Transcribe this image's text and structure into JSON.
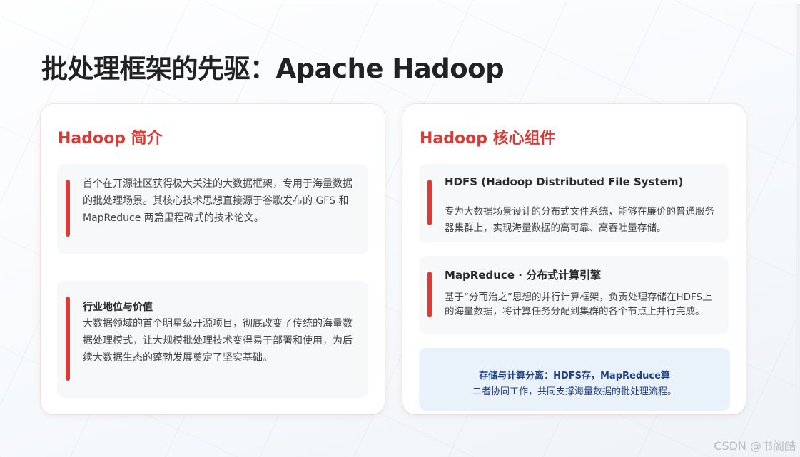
{
  "slide": {
    "title": "批处理框架的先驱：Apache Hadoop"
  },
  "left_card": {
    "title": "Hadoop 简介",
    "intro_text": "首个在开源社区获得极大关注的大数据框架，专用于海量数据的批处理场景。其核心技术思想直接源于谷歌发布的 GFS 和 MapReduce 两篇里程碑式的技术论文。",
    "status_heading": "行业地位与价值",
    "status_text": "大数据领域的首个明星级开源项目，彻底改变了传统的海量数据处理模式，让大规模批处理技术变得易于部署和使用，为后续大数据生态的蓬勃发展奠定了坚实基础。"
  },
  "right_card": {
    "title": "Hadoop 核心组件",
    "components": [
      {
        "heading": "HDFS (Hadoop Distributed File System)",
        "text": "专为大数据场景设计的分布式文件系统，能够在廉价的普通服务器集群上，实现海量数据的高可靠、高吞吐量存储。"
      },
      {
        "heading": "MapReduce · 分布式计算引擎",
        "text": "基于“分而治之”思想的并行计算框架，负责处理存储在HDFS上的海量数据，将计算任务分配到集群的各个节点上并行完成。"
      }
    ],
    "summary_line1": "存储与计算分离：HDFS存，MapReduce算",
    "summary_line2": "二者协同工作，共同支撑海量数据的批处理流程。"
  },
  "watermark": "CSDN @书阁酷",
  "colors": {
    "accent_red": "#dc3a36",
    "title_dark": "#222222",
    "summary_blue": "#1f3f86",
    "box_bg": "#f7f8fa",
    "summary_bg": "#e9f1fb"
  }
}
